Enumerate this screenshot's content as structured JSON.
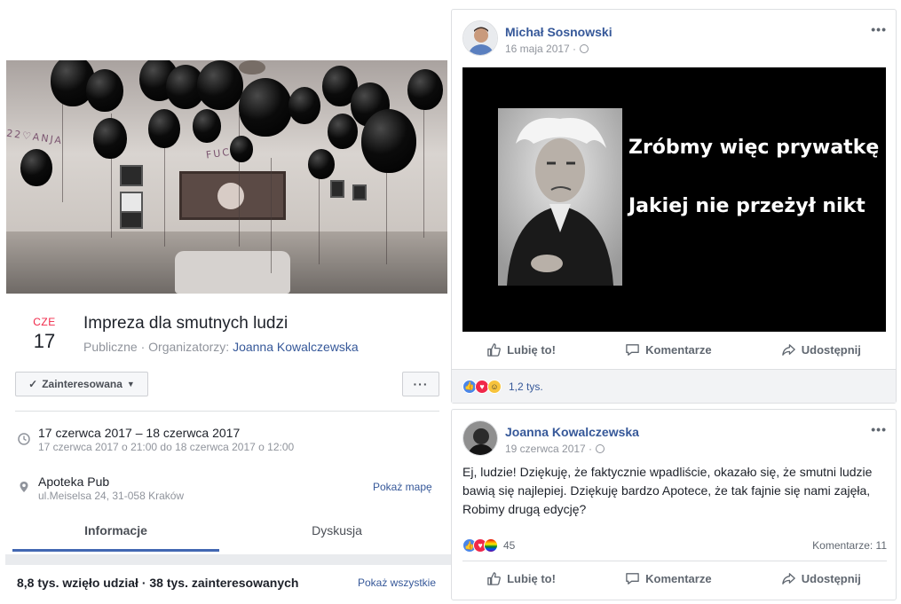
{
  "event": {
    "month": "CZE",
    "day": "17",
    "title": "Impreza dla smutnych ludzi",
    "subtitle_prefix": "Publiczne · Organizatorzy: ",
    "organizer": "Joanna Kowalczewska",
    "interested_label": "Zainteresowana",
    "more_label": "···",
    "time_main": "17 czerwca 2017 – 18 czerwca 2017",
    "time_sub": "17 czerwca 2017 o 21:00 do 18 czerwca 2017 o 12:00",
    "place_main": "Apoteka Pub",
    "place_sub": "ul.Meiselsa 24, 31-058 Kraków",
    "map_link": "Pokaż mapę",
    "tabs": [
      "Informacje",
      "Dyskusja"
    ],
    "attendance": "8,8 tys. wzięło udział · 38 tys. zainteresowanych",
    "show_all": "Pokaż wszystkie",
    "cover_banner": "22♡ANJA",
    "cover_banner2": "FUCK"
  },
  "post1": {
    "author": "Michał Sosnowski",
    "date": "16 maja 2017 ·",
    "meme_line1": "Zróbmy więc prywatkę",
    "meme_line2": "Jakiej nie przeżył nikt",
    "actions": [
      "Lubię to!",
      "Komentarze",
      "Udostępnij"
    ],
    "reaction_count": "1,2 tys."
  },
  "post2": {
    "author": "Joanna Kowalczewska",
    "date": "19 czerwca 2017 ·",
    "text": "Ej, ludzie! Dziękuję, że faktycznie wpadliście, okazało się, że smutni ludzie bawią się najlepiej. Dziękuję bardzo Apotece, że tak fajnie się nami zajęła, Robimy drugą edycję?",
    "reaction_count": "45",
    "comments": "Komentarze: 11",
    "actions": [
      "Lubię to!",
      "Komentarze",
      "Udostępnij"
    ]
  },
  "colors": {
    "link": "#365899",
    "accent_red": "#f02849",
    "tab_underline": "#4267b2"
  }
}
